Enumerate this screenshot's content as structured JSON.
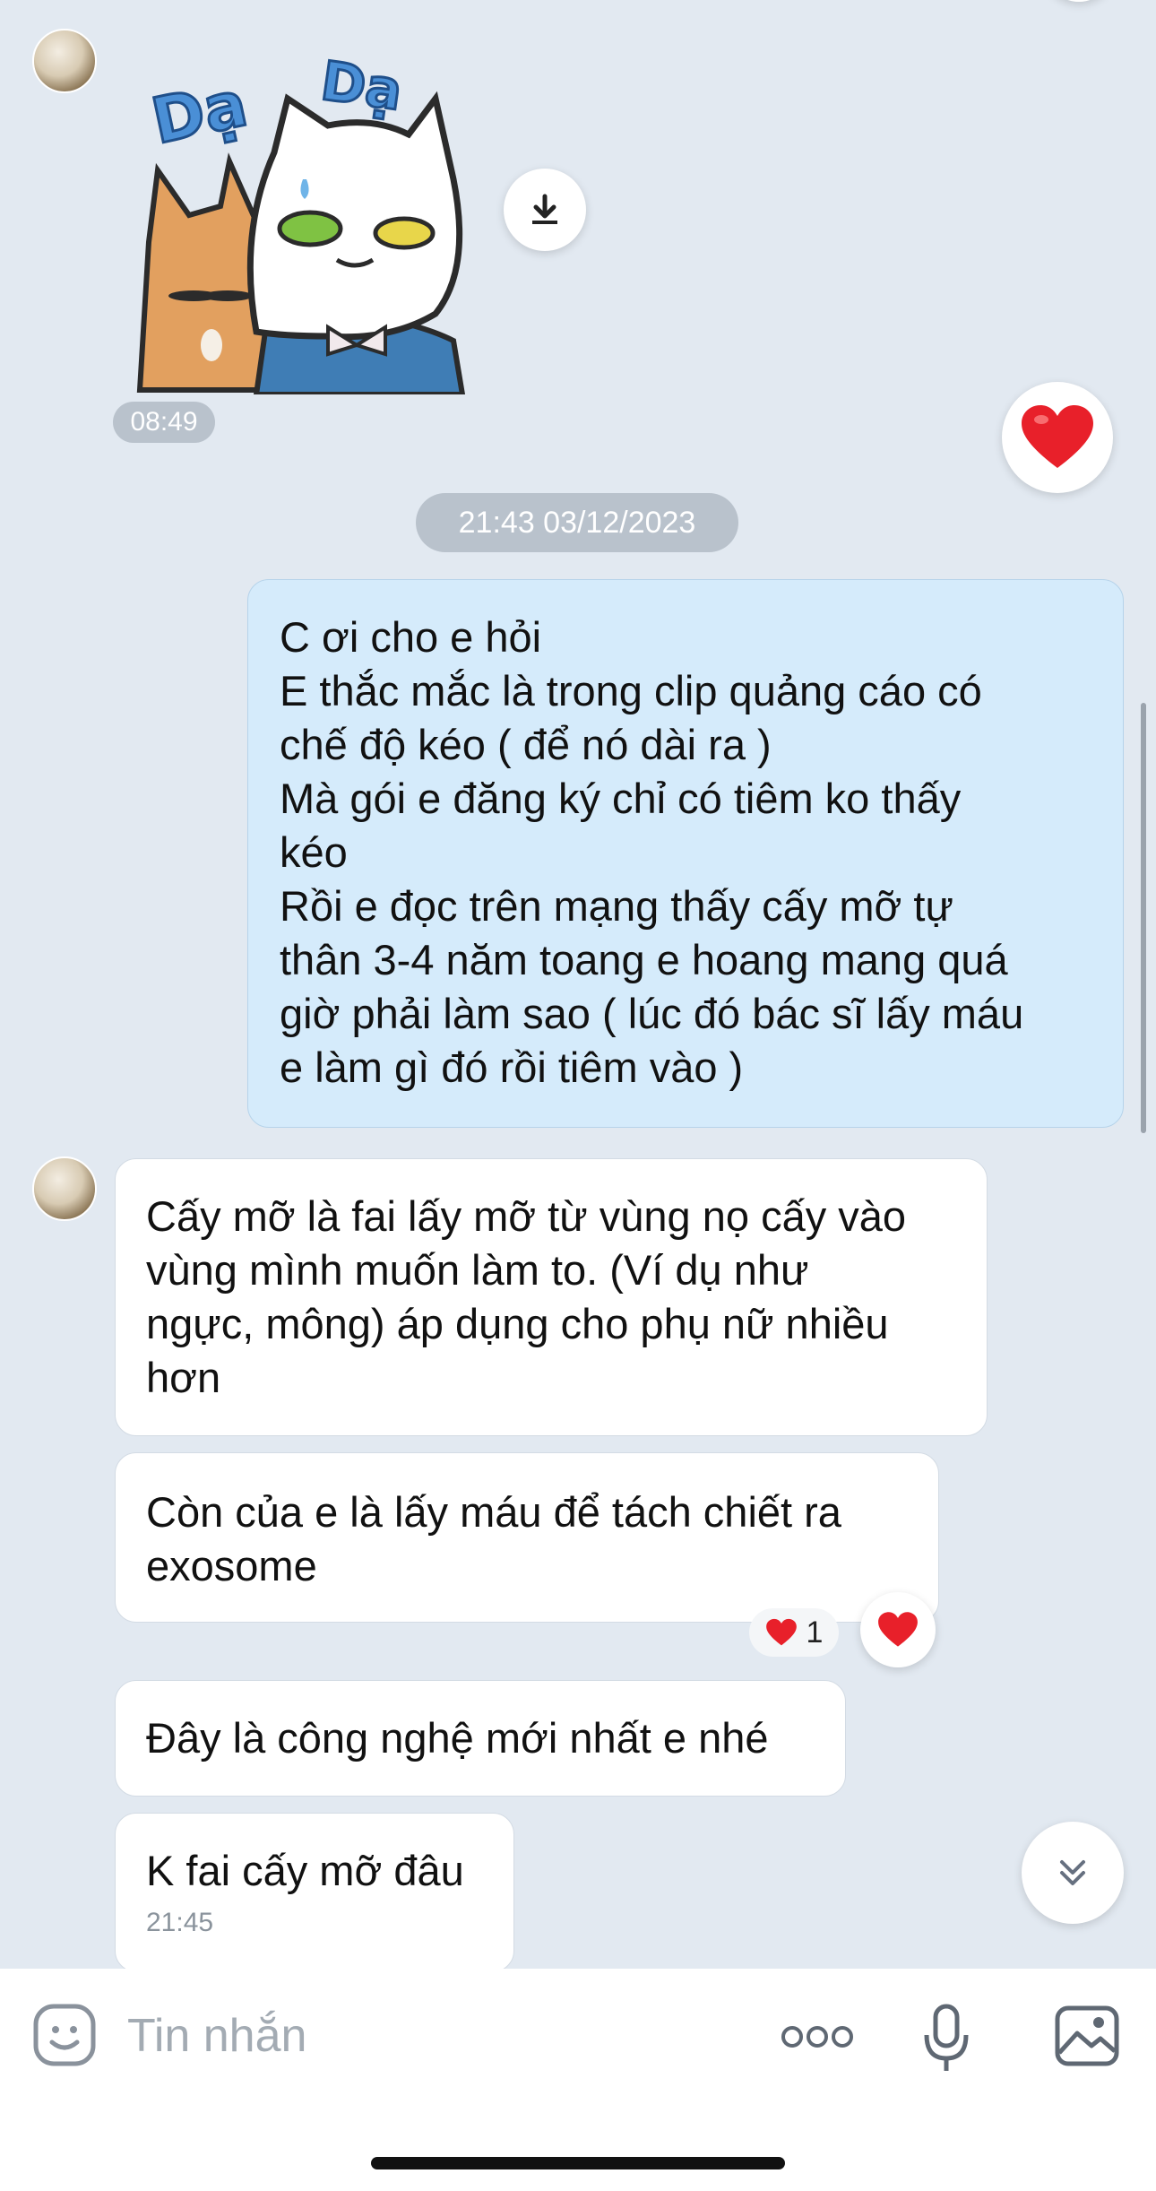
{
  "sticker": {
    "left_text": "Dạ",
    "right_text": "Dạ",
    "time": "08:49"
  },
  "date_divider": "21:43 03/12/2023",
  "sent_message": {
    "lines": [
      "C ơi cho e hỏi",
      "E thắc mắc là trong clip quảng cáo có",
      "chế độ kéo ( để nó dài ra )",
      "Mà gói e đăng ký chỉ có tiêm ko thấy",
      "kéo",
      "Rồi e đọc trên mạng thấy cấy mỡ tự",
      "thân 3-4 năm toang e hoang mang quá",
      "giờ phải làm sao ( lúc đó bác sĩ lấy máu",
      "e làm gì đó rồi tiêm vào )"
    ]
  },
  "received_messages": [
    {
      "lines": [
        "Cấy mỡ là fai lấy mỡ từ vùng nọ cấy vào",
        "vùng mình muốn làm to. (Ví dụ như",
        "ngực, mông) áp dụng cho phụ nữ nhiều",
        "hơn"
      ]
    },
    {
      "lines": [
        "Còn của e là lấy máu để tách chiết ra",
        "exosome"
      ],
      "reaction_count": "1"
    },
    {
      "lines": [
        "Đây là công nghệ mới nhất e nhé"
      ]
    },
    {
      "lines": [
        "K fai cấy mỡ đâu"
      ],
      "time": "21:45"
    }
  ],
  "composer": {
    "placeholder": "Tin nhắn"
  },
  "colors": {
    "background": "#e2e9f1",
    "sent_bubble": "#d5ebfb",
    "heart": "#e8202a"
  }
}
